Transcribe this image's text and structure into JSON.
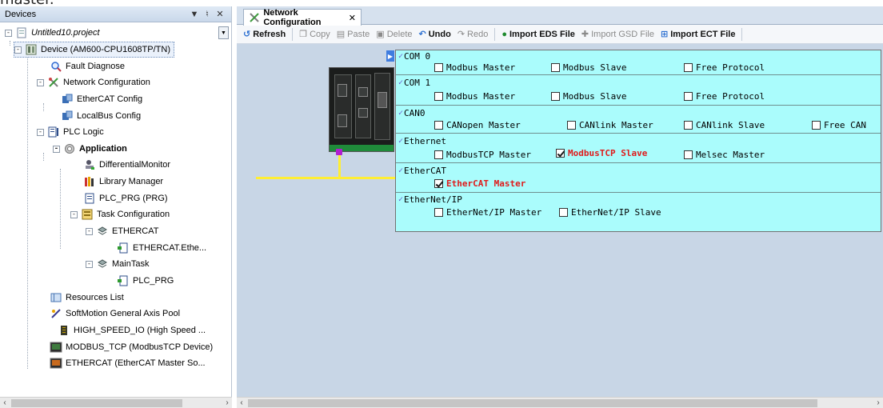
{
  "caption": "master.",
  "devices_panel": {
    "title": "Devices",
    "pin_label": "▕ '",
    "close_label": "✕",
    "project": "Untitled10.project"
  },
  "tree": [
    {
      "label": "Device (AM600-CPU1608TP/TN)",
      "icon": "device-icon"
    },
    {
      "label": "Fault Diagnose",
      "icon": "magnifier-icon"
    },
    {
      "label": "Network Configuration",
      "icon": "network-config-icon"
    },
    {
      "label": "EtherCAT Config",
      "icon": "ethercat-config-icon"
    },
    {
      "label": "LocalBus Config",
      "icon": "localbus-config-icon"
    },
    {
      "label": "PLC Logic",
      "icon": "plc-logic-icon"
    },
    {
      "label": "Application",
      "icon": "application-gear-icon"
    },
    {
      "label": "DifferentialMonitor",
      "icon": "monitor-icon"
    },
    {
      "label": "Library Manager",
      "icon": "library-icon"
    },
    {
      "label": "PLC_PRG (PRG)",
      "icon": "program-icon"
    },
    {
      "label": "Task Configuration",
      "icon": "task-config-icon"
    },
    {
      "label": "ETHERCAT",
      "icon": "task-icon"
    },
    {
      "label": "ETHERCAT.Ethe...",
      "icon": "task-call-icon"
    },
    {
      "label": "MainTask",
      "icon": "task-icon"
    },
    {
      "label": "PLC_PRG",
      "icon": "task-call-icon"
    },
    {
      "label": "Resources List",
      "icon": "resources-icon"
    },
    {
      "label": "SoftMotion General Axis Pool",
      "icon": "axis-pool-icon"
    },
    {
      "label": "HIGH_SPEED_IO (High Speed ...",
      "icon": "io-module-icon"
    },
    {
      "label": "MODBUS_TCP (ModbusTCP Device)",
      "icon": "modbus-device-icon"
    },
    {
      "label": "ETHERCAT (EtherCAT Master So...",
      "icon": "ethercat-master-icon"
    }
  ],
  "editor": {
    "tab_label": "Network Configuration",
    "toolbar": {
      "refresh": "Refresh",
      "copy": "Copy",
      "paste": "Paste",
      "delete": "Delete",
      "undo": "Undo",
      "redo": "Redo",
      "import_eds": "Import EDS File",
      "import_gsd": "Import GSD File",
      "import_ect": "Import ECT File"
    }
  },
  "config_table": [
    {
      "port": "COM 0",
      "options": [
        {
          "label": "Modbus Master",
          "checked": false
        },
        {
          "label": "Modbus Slave",
          "checked": false
        },
        {
          "label": "Free Protocol",
          "checked": false
        }
      ]
    },
    {
      "port": "COM 1",
      "options": [
        {
          "label": "Modbus Master",
          "checked": false
        },
        {
          "label": "Modbus Slave",
          "checked": false
        },
        {
          "label": "Free Protocol",
          "checked": false
        }
      ]
    },
    {
      "port": "CAN0",
      "options": [
        {
          "label": "CANopen Master",
          "checked": false
        },
        {
          "label": "CANlink Master",
          "checked": false
        },
        {
          "label": "CANlink Slave",
          "checked": false
        },
        {
          "label": "Free CAN",
          "checked": false
        }
      ]
    },
    {
      "port": "Ethernet",
      "options": [
        {
          "label": "ModbusTCP Master",
          "checked": false
        },
        {
          "label": "ModbusTCP Slave",
          "checked": true
        },
        {
          "label": "Melsec Master",
          "checked": false
        }
      ]
    },
    {
      "port": "EtherCAT",
      "options": [
        {
          "label": "EtherCAT Master",
          "checked": true
        }
      ]
    },
    {
      "port": "EtherNet/IP",
      "options": [
        {
          "label": "EtherNet/IP Master",
          "checked": false
        },
        {
          "label": "EtherNet/IP Slave",
          "checked": false
        }
      ]
    }
  ],
  "colors": {
    "config_bg": "#aafcfc",
    "active_option": "#e01b1b",
    "bus_line": "#ffee33",
    "canvas_bg": "#c8d6e6"
  }
}
